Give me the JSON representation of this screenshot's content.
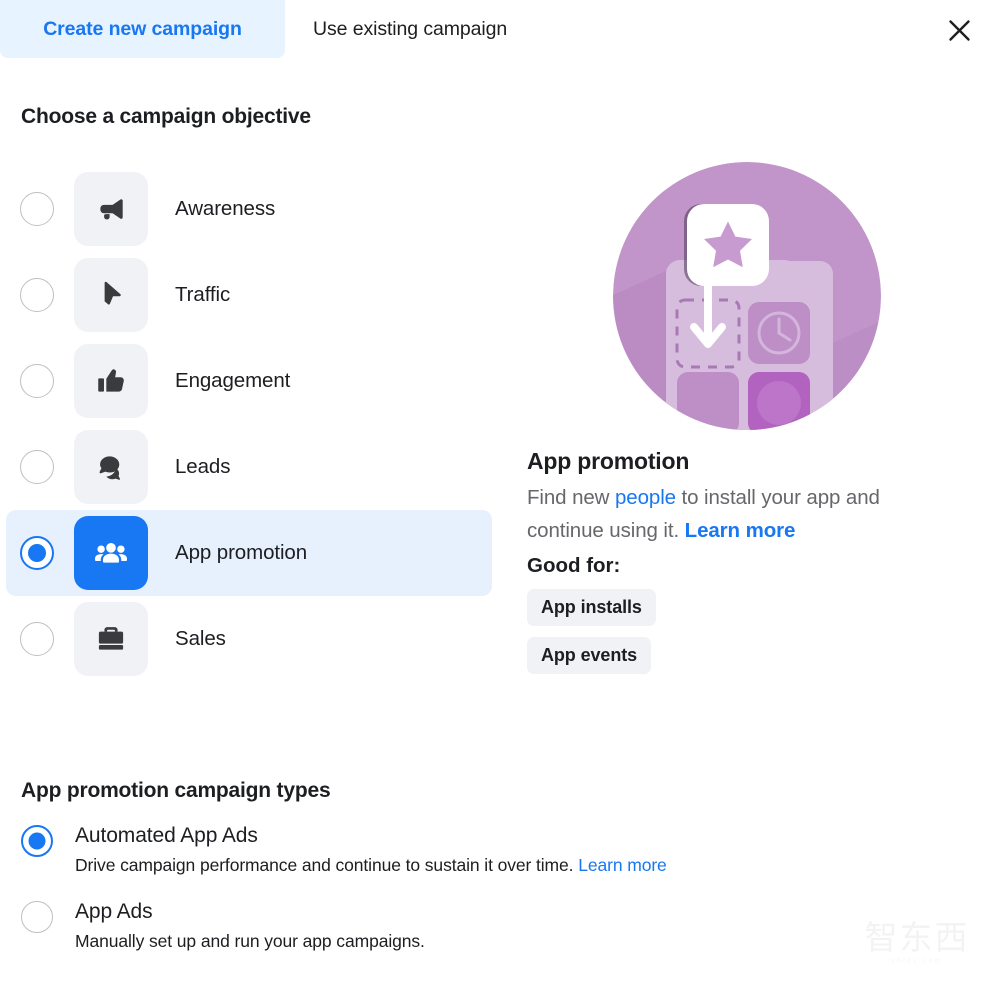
{
  "tabs": [
    {
      "label": "Create new campaign",
      "active": true
    },
    {
      "label": "Use existing campaign",
      "active": false
    }
  ],
  "close_icon": "close-icon",
  "objective_section": {
    "title": "Choose a campaign objective",
    "options": [
      {
        "label": "Awareness",
        "icon": "megaphone-icon",
        "selected": false
      },
      {
        "label": "Traffic",
        "icon": "cursor-icon",
        "selected": false
      },
      {
        "label": "Engagement",
        "icon": "thumbs-up-icon",
        "selected": false
      },
      {
        "label": "Leads",
        "icon": "chat-bubbles-icon",
        "selected": false
      },
      {
        "label": "App promotion",
        "icon": "people-group-icon",
        "selected": true
      },
      {
        "label": "Sales",
        "icon": "briefcase-icon",
        "selected": false
      }
    ]
  },
  "detail": {
    "illustration": "app-promotion-illustration",
    "title": "App promotion",
    "desc_part1": "Find new ",
    "desc_link": "people",
    "desc_part2": " to install your app and continue using it. ",
    "desc_learn_more": "Learn more",
    "good_for_label": "Good for:",
    "badges": [
      "App installs",
      "App events"
    ]
  },
  "types_section": {
    "title": "App promotion campaign types",
    "options": [
      {
        "name": "Automated App Ads",
        "desc": "Drive campaign performance and continue to sustain it over time. ",
        "learn_more": "Learn more",
        "selected": true
      },
      {
        "name": "App Ads",
        "desc": "Manually set up and run your app campaigns.",
        "learn_more": "",
        "selected": false
      }
    ]
  },
  "watermark": {
    "text": "智东西",
    "subtext": "zhidx.com"
  },
  "colors": {
    "accent_blue": "#1877f2",
    "tab_active_bg": "#e7f3ff",
    "row_selected_bg": "#e7f0fd",
    "tile_bg": "#f0f2f5",
    "icon_dark": "#3a3b3c",
    "text_primary": "#1c1e21",
    "text_secondary": "#65676b",
    "illustration_purple": "#bf92c8"
  }
}
